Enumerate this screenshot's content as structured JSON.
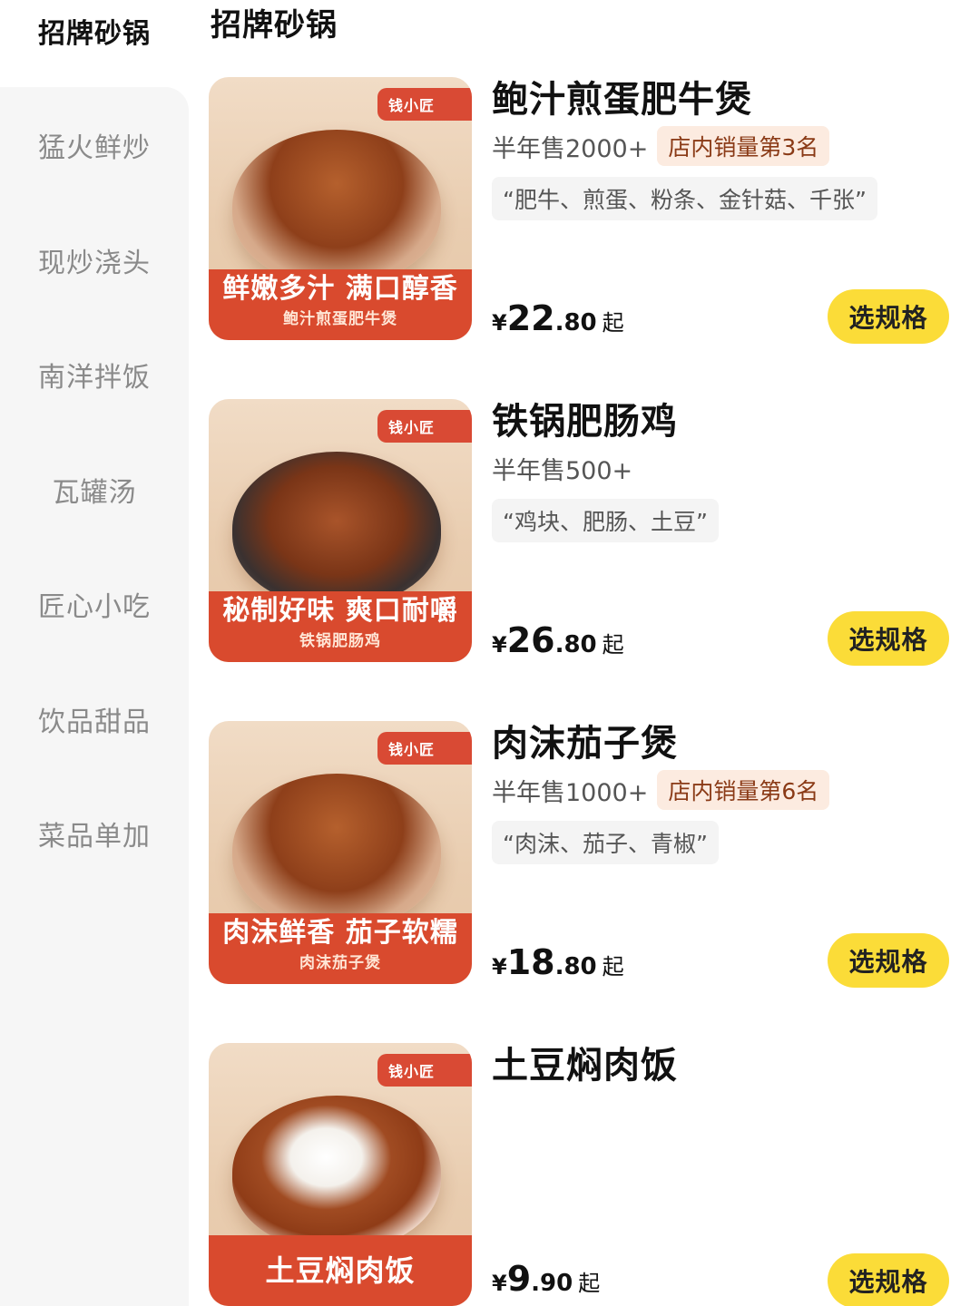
{
  "sidebar": {
    "items": [
      {
        "label": "招牌砂锅",
        "active": true
      },
      {
        "label": "猛火鲜炒",
        "active": false
      },
      {
        "label": "现炒浇头",
        "active": false
      },
      {
        "label": "南洋拌饭",
        "active": false
      },
      {
        "label": "瓦罐汤",
        "active": false
      },
      {
        "label": "匠心小吃",
        "active": false
      },
      {
        "label": "饮品甜品",
        "active": false
      },
      {
        "label": "菜品单加",
        "active": false
      }
    ]
  },
  "main": {
    "section_title": "招牌砂锅",
    "products": [
      {
        "name": "鲍汁煎蛋肥牛煲",
        "sales": "半年售2000+",
        "rank": "店内销量第3名",
        "tags": "“肥牛、煎蛋、粉条、金针菇、千张”",
        "image": {
          "brand": "钱小匠",
          "banner_big": "鲜嫩多汁 满口醇香",
          "banner_small": "鲍汁煎蛋肥牛煲"
        },
        "price": {
          "currency": "¥",
          "int": "22",
          "dec": ".80",
          "suffix": "起"
        },
        "button": "选规格"
      },
      {
        "name": "铁锅肥肠鸡",
        "sales": "半年售500+",
        "rank": "",
        "tags": "“鸡块、肥肠、土豆”",
        "image": {
          "brand": "钱小匠",
          "banner_big": "秘制好味 爽口耐嚼",
          "banner_small": "铁锅肥肠鸡"
        },
        "price": {
          "currency": "¥",
          "int": "26",
          "dec": ".80",
          "suffix": "起"
        },
        "button": "选规格"
      },
      {
        "name": "肉沫茄子煲",
        "sales": "半年售1000+",
        "rank": "店内销量第6名",
        "tags": "“肉沫、茄子、青椒”",
        "image": {
          "brand": "钱小匠",
          "banner_big": "肉沫鲜香 茄子软糯",
          "banner_small": "肉沫茄子煲"
        },
        "price": {
          "currency": "¥",
          "int": "18",
          "dec": ".80",
          "suffix": "起"
        },
        "button": "选规格"
      },
      {
        "name": "土豆焖肉饭",
        "sales": "",
        "rank": "",
        "tags": "",
        "image": {
          "brand": "钱小匠",
          "banner_big": "土豆焖肉饭",
          "banner_small": ""
        },
        "price": {
          "currency": "¥",
          "int": "9",
          "dec": ".90",
          "suffix": "起"
        },
        "button": "选规格"
      }
    ]
  },
  "colors": {
    "accent_button": "#fbdc38",
    "rank_bg": "#fcebe0",
    "rank_text": "#8a3a16",
    "banner_red": "#d94a2e",
    "sidebar_bg": "#f6f6f6"
  }
}
